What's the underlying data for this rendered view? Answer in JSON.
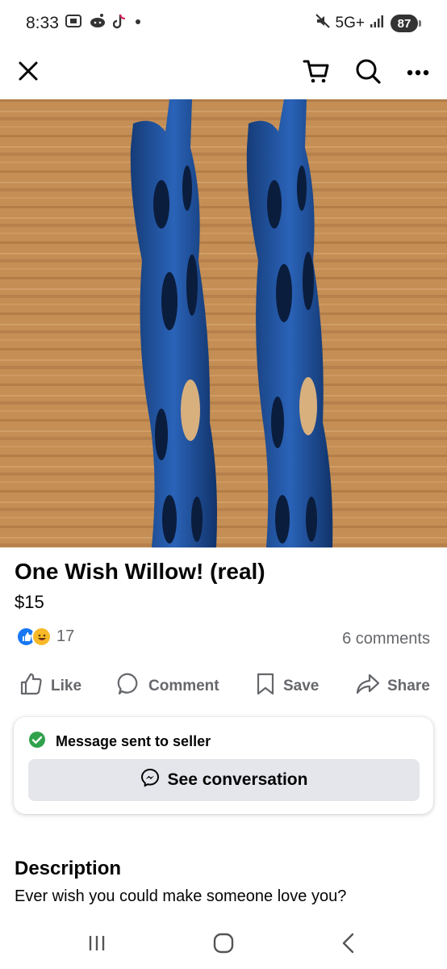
{
  "status_bar": {
    "time": "8:33",
    "network": "5G+",
    "battery": "87",
    "icons": [
      "screenshot-icon",
      "reddit-icon",
      "tiktok-icon",
      "dot-icon",
      "mute-icon",
      "signal-icon"
    ]
  },
  "top_bar": {
    "close_icon": "close-icon",
    "cart_icon": "cart-icon",
    "search_icon": "search-icon",
    "more_icon": "more-icon"
  },
  "listing": {
    "image_alt": "Two blue 3D-printed lattice wands on a wooden table",
    "title": "One Wish Willow! (real)",
    "price": "$15",
    "reaction_count": "17",
    "comments": "6 comments"
  },
  "actions": {
    "like": "Like",
    "comment": "Comment",
    "save": "Save",
    "share": "Share"
  },
  "message_card": {
    "status": "Message sent to seller",
    "button": "See conversation"
  },
  "description": {
    "heading": "Description",
    "text": "Ever wish you could make someone love you?"
  },
  "colors": {
    "secondary_text": "#65676b",
    "button_bg": "#e4e6eb",
    "like_blue": "#1877f2",
    "success_green": "#31a24c",
    "wand_blue": "#1d4f9c"
  }
}
